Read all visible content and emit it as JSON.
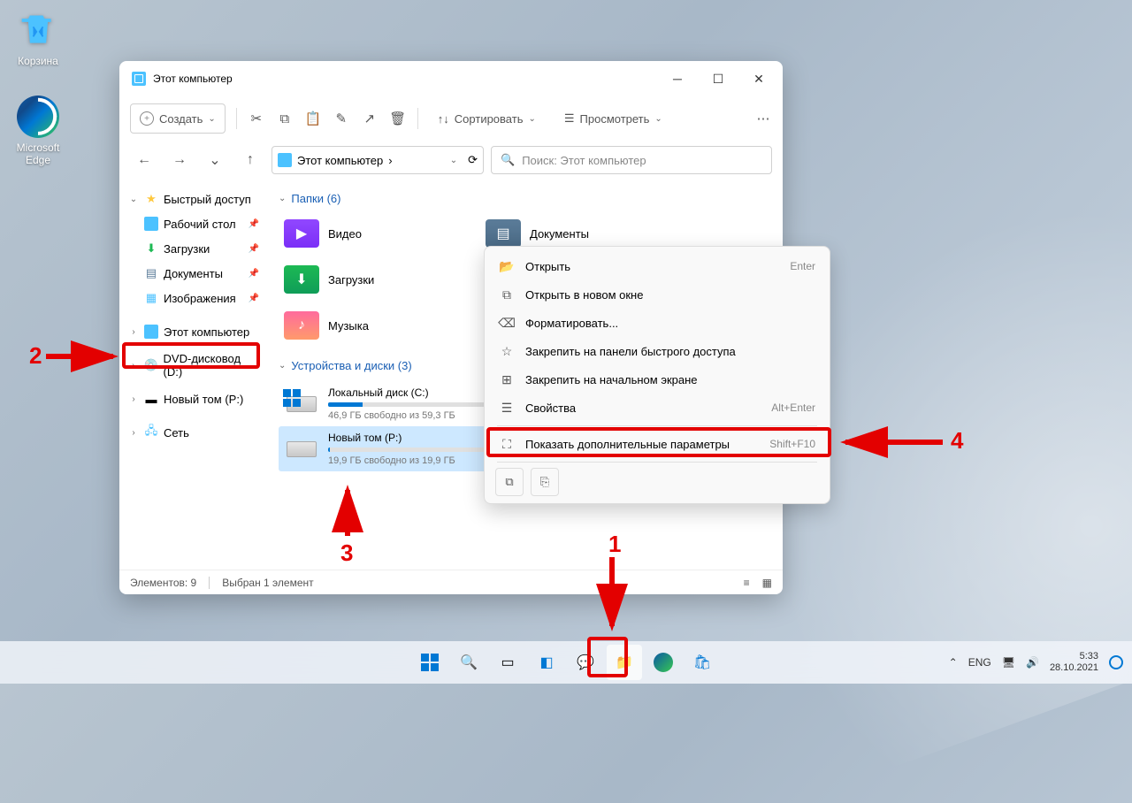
{
  "desktop": {
    "recycle": "Корзина",
    "edge": "Microsoft Edge"
  },
  "window": {
    "title": "Этот компьютер",
    "toolbar": {
      "new": "Создать",
      "sort": "Сортировать",
      "view": "Просмотреть"
    },
    "address": "Этот компьютер",
    "search_placeholder": "Поиск: Этот компьютер",
    "sidebar": {
      "quick": "Быстрый доступ",
      "items": [
        "Рабочий стол",
        "Загрузки",
        "Документы",
        "Изображения"
      ],
      "thispc": "Этот компьютер",
      "dvd": "DVD-дисковод (D:)",
      "newvol": "Новый том (P:)",
      "network": "Сеть"
    },
    "groups": {
      "folders": "Папки (6)",
      "devices": "Устройства и диски (3)"
    },
    "folders": [
      "Видео",
      "Документы",
      "Загрузки",
      "Музыка"
    ],
    "drives": [
      {
        "name": "Локальный диск (C:)",
        "free": "46,9 ГБ свободно из 59,3 ГБ",
        "pct": 22
      },
      {
        "name": "Новый том (P:)",
        "free": "19,9 ГБ свободно из 19,9 ГБ",
        "pct": 1
      }
    ],
    "status": {
      "count": "Элементов: 9",
      "sel": "Выбран 1 элемент"
    }
  },
  "ctx": {
    "items": [
      {
        "label": "Открыть",
        "shortcut": "Enter",
        "icon": "folder"
      },
      {
        "label": "Открыть в новом окне",
        "icon": "window"
      },
      {
        "label": "Форматировать...",
        "icon": "format"
      },
      {
        "label": "Закрепить на панели быстрого доступа",
        "icon": "pin"
      },
      {
        "label": "Закрепить на начальном экране",
        "icon": "pinstart"
      },
      {
        "label": "Свойства",
        "shortcut": "Alt+Enter",
        "icon": "props"
      },
      {
        "label": "Показать дополнительные параметры",
        "shortcut": "Shift+F10",
        "icon": "more"
      }
    ]
  },
  "taskbar": {
    "lang": "ENG",
    "time": "5:33",
    "date": "28.10.2021"
  },
  "annotations": [
    "1",
    "2",
    "3",
    "4"
  ]
}
